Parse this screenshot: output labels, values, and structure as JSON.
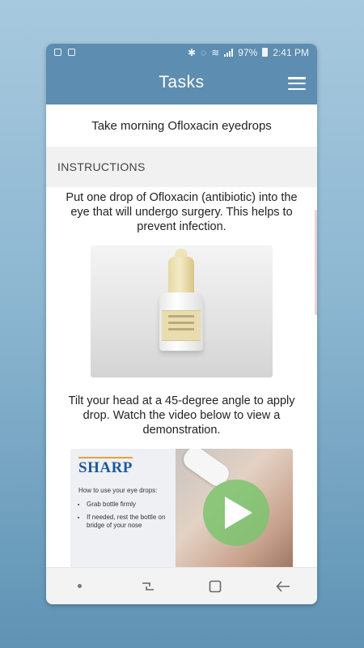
{
  "status_bar": {
    "battery": "97%",
    "time": "2:41 PM"
  },
  "app_bar": {
    "title": "Tasks",
    "menu_icon": "hamburger-menu-icon"
  },
  "task": {
    "title": "Take morning Ofloxacin eyedrops"
  },
  "instructions": {
    "header": "INSTRUCTIONS",
    "paragraph_1": "Put one drop of Ofloxacin (antibiotic) into the eye that will undergo surgery. This helps to prevent infection.",
    "paragraph_2": "Tilt your head at a 45-degree angle to apply drop. Watch the video below to view a demonstration."
  },
  "video": {
    "brand": "SHARP",
    "heading": "How to use your eye drops:",
    "bullets": [
      "Grab bottle firmly",
      "If needed, rest the bottle on bridge of your nose"
    ],
    "play_icon": "play-icon"
  },
  "nav_bar": {
    "icons": [
      "dot-icon",
      "recents-icon",
      "home-icon",
      "back-icon"
    ]
  },
  "colors": {
    "primary": "#5d8db0",
    "play": "#7bc46e"
  }
}
